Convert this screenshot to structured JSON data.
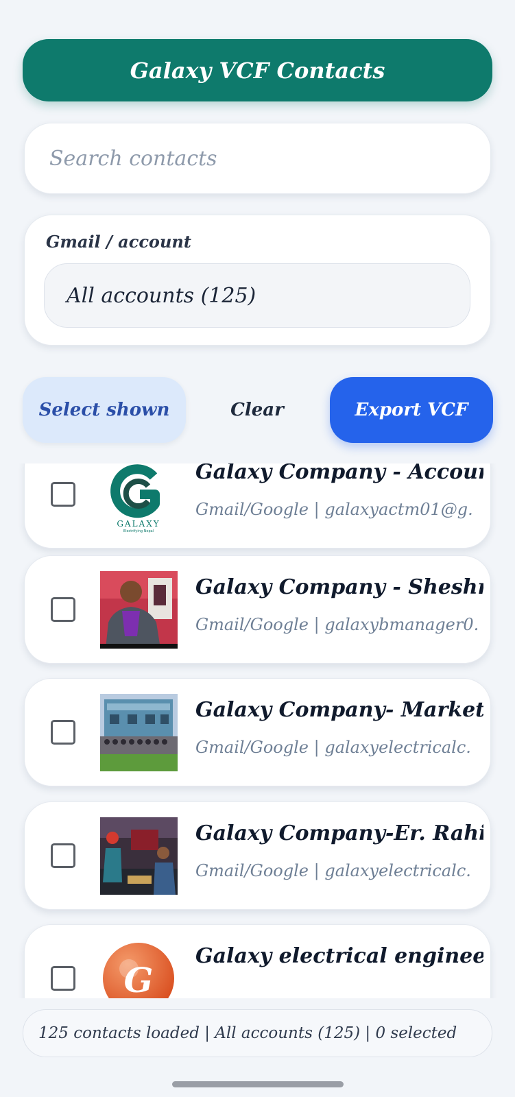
{
  "app": {
    "title": "Galaxy VCF Contacts"
  },
  "search": {
    "placeholder": "Search contacts",
    "value": ""
  },
  "filter": {
    "label": "Gmail / account",
    "selected": "All accounts (125)"
  },
  "actions": {
    "select_shown": "Select shown",
    "clear": "Clear",
    "export": "Export VCF"
  },
  "contacts": [
    {
      "name": "Galaxy Company - Account.",
      "sub": "Gmail/Google | galaxyactm01@g.",
      "avatar": "galaxy-logo-image",
      "logo_text": "GALAXY",
      "logo_tagline": "Electrifying Nepal",
      "checked": false
    },
    {
      "name": "Galaxy Company - Sheshna.",
      "sub": "Gmail/Google | galaxybmanager0.",
      "avatar": "person-photo",
      "checked": false
    },
    {
      "name": "Galaxy Company- Marketin.",
      "sub": "Gmail/Google | galaxyelectricalc.",
      "avatar": "group-building-photo",
      "checked": false
    },
    {
      "name": "Galaxy Company-Er.  Rahis.",
      "sub": "Gmail/Google | galaxyelectricalc.",
      "avatar": "showroom-photo",
      "checked": false
    },
    {
      "name": "Galaxy electrical engineerin.",
      "sub": "",
      "avatar": "letter-avatar",
      "initial": "G",
      "checked": false
    }
  ],
  "status": {
    "text": "125 contacts loaded | All accounts (125) | 0 selected"
  },
  "colors": {
    "header": "#0e7a6c",
    "export": "#2563eb",
    "select_bg": "#dce9fb",
    "avatar_orange": "#e8652b"
  }
}
